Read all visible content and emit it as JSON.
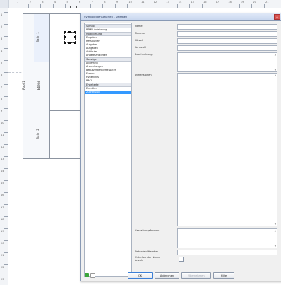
{
  "ruler": {
    "unit_label": "cm",
    "top_ticks": [
      "1",
      "2",
      "3",
      "4",
      "5",
      "6",
      "7",
      "8",
      "9",
      "10",
      "11",
      "12",
      "13",
      "14",
      "15",
      "16",
      "17",
      "18",
      "19",
      "20",
      "21"
    ],
    "left_ticks": [
      "1",
      "2",
      "3",
      "4",
      "5",
      "6",
      "7",
      "8",
      "9",
      "10",
      "11",
      "12",
      "13",
      "14",
      "15",
      "16",
      "17",
      "18",
      "19",
      "20",
      "21",
      "22",
      "23"
    ]
  },
  "diagram": {
    "pool_label": "Pool 1",
    "lanes": [
      {
        "label": "Bahn 1"
      },
      {
        "label": "Ebene"
      },
      {
        "label": "Bahn 2"
      }
    ]
  },
  "dialog": {
    "title": "Symboleigenschaften - Swerpen",
    "close_glyph": "×",
    "tree": [
      {
        "label": "Symbol",
        "group": true
      },
      {
        "label": "BPMN-Anlehnung",
        "group": false
      },
      {
        "label": "Modellierung",
        "group": true
      },
      {
        "label": "Eingaben",
        "group": false
      },
      {
        "label": "Ressourcen",
        "group": false
      },
      {
        "label": "Aufgaben",
        "group": false
      },
      {
        "label": "Ausgaben",
        "group": false
      },
      {
        "label": "Attribute",
        "group": false
      },
      {
        "label": "Andere Ansichten",
        "group": false
      },
      {
        "label": "Sonstige",
        "group": true
      },
      {
        "label": "Allgemein",
        "group": false
      },
      {
        "label": "Anmerkungen",
        "group": false
      },
      {
        "label": "Benutzerdefinierte Daten",
        "group": false
      },
      {
        "label": "Farben",
        "group": false
      },
      {
        "label": "Hyperlinks",
        "group": false
      },
      {
        "label": "RACI",
        "group": false
      },
      {
        "label": "Erweiterte",
        "group": true
      },
      {
        "label": "Eintritten",
        "group": false
      },
      {
        "label": "Zuordnung",
        "group": false,
        "selected": true
      }
    ],
    "fields": {
      "name_label": "Name",
      "nummer_label": "Nummer",
      "kuerzel_label": "Kürzel",
      "kennzahl_label": "Kennzahl",
      "beschreibung_label": "Beschreibung",
      "dimensionen_label": "Dimensionen",
      "gestaltungsformen_label": "Gestaltungsformen",
      "datenfeld_label": "Datenfeld Handler",
      "unterlaender_label": "Unterlaender Name Anzahl"
    },
    "buttons": {
      "ok": "OK",
      "abbrechen": "Abbrechen",
      "uebernehmen": "Übernehmen",
      "hilfe": "Hilfe"
    },
    "status_colors": {
      "ok": "#3aa53a",
      "warn": "#e0b21a"
    }
  },
  "colors": {
    "selection_blue": "#3399ff",
    "title_bar": "#c9d7ef"
  }
}
